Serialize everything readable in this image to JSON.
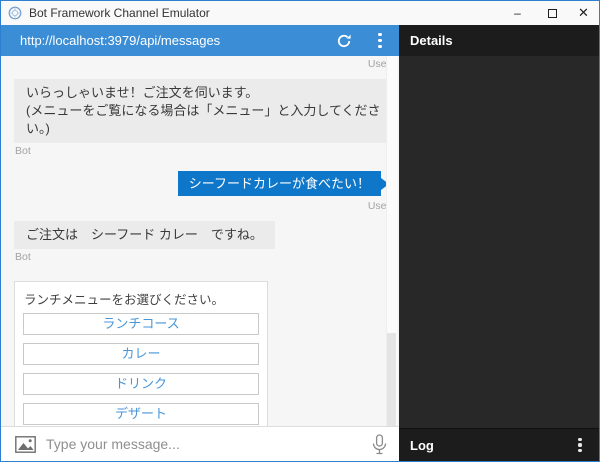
{
  "window": {
    "title": "Bot Framework Channel Emulator",
    "controls": {
      "minimize": "–",
      "close": "✕"
    }
  },
  "address_bar": {
    "url": "http://localhost:3979/api/messages"
  },
  "chat": {
    "partial_user_label": "User",
    "bot1": {
      "text": "いらっしゃいませ！ご注文を伺います。\n(メニューをご覧になる場合は「メニュー」と入力してくださ\nい。)",
      "label": "Bot"
    },
    "user1": {
      "text": "シーフードカレーが食べたい！",
      "label": "User"
    },
    "bot2": {
      "text": "ご注文は　シーフード カレー　ですね。",
      "label": "Bot"
    },
    "card": {
      "prompt": "ランチメニューをお選びください。",
      "buttons": [
        "ランチコース",
        "カレー",
        "ドリンク",
        "デザート"
      ]
    }
  },
  "composer": {
    "placeholder": "Type your message..."
  },
  "details_panel": {
    "title": "Details"
  },
  "log_panel": {
    "title": "Log"
  },
  "colors": {
    "address_bar_blue": "#3b8ed6",
    "user_bubble_blue": "#0f77c9",
    "bot_bubble_gray": "#ebebeb",
    "panel_dark": "#282828",
    "panel_header_dark": "#1c1c1c",
    "button_text_blue": "#4796d8"
  }
}
